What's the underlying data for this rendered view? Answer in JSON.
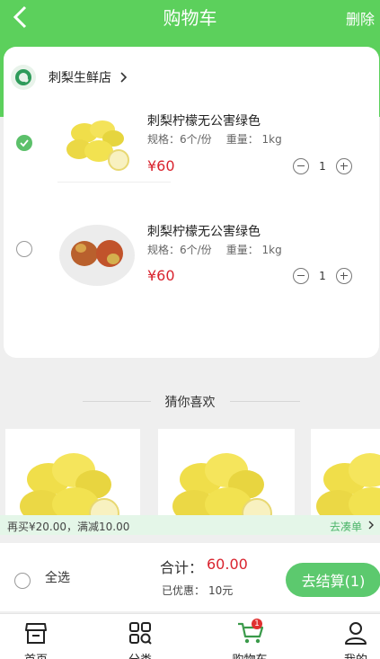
{
  "header": {
    "title": "购物车",
    "delete_label": "删除"
  },
  "store": {
    "name": "刺梨生鲜店"
  },
  "cart_items": [
    {
      "name": "刺梨柠檬无公害绿色",
      "spec_label": "规格：6个/份",
      "weight_label": "重量： 1kg",
      "price": "¥60",
      "quantity": "1",
      "selected": true
    },
    {
      "name": "刺梨柠檬无公害绿色",
      "spec_label": "规格：6个/份",
      "weight_label": "重量： 1kg",
      "price": "¥60",
      "quantity": "1",
      "selected": false
    }
  ],
  "recommend": {
    "title": "猜你喜欢"
  },
  "promo": {
    "text": "再买¥20.00，满减10.00",
    "link": "去凑单"
  },
  "summary": {
    "select_all": "全选",
    "total_label": "合计：",
    "total_value": "60.00",
    "discount_label": "已优惠：",
    "discount_value": "10元",
    "checkout_label": "去结算(1)"
  },
  "tabs": [
    {
      "label": "首页",
      "icon": "home-store-icon"
    },
    {
      "label": "分类",
      "icon": "category-grid-icon"
    },
    {
      "label": "购物车",
      "icon": "cart-icon",
      "badge": "1"
    },
    {
      "label": "我的",
      "icon": "user-icon"
    }
  ],
  "colors": {
    "accent": "#5cd05c",
    "price": "#d9232e",
    "checkout": "#5cc96e"
  }
}
